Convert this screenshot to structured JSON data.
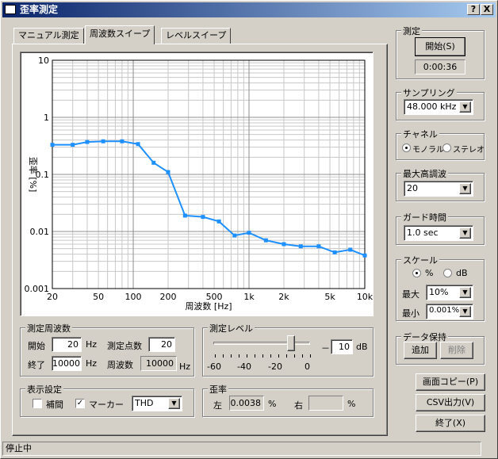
{
  "window": {
    "title": "歪率測定",
    "help_btn": "?",
    "close_btn": "X"
  },
  "tabs": [
    {
      "label": "マニュアル測定",
      "active": false
    },
    {
      "label": "周波数スイープ",
      "active": true
    },
    {
      "label": "レベルスイープ",
      "active": false
    }
  ],
  "chart_data": {
    "type": "line",
    "xscale": "log",
    "yscale": "log",
    "xlim": [
      20,
      10000
    ],
    "ylim": [
      0.001,
      10
    ],
    "xlabel": "周波数 [Hz]",
    "ylabel": "歪率 [%]",
    "x_ticks": [
      "20",
      "50",
      "100",
      "200",
      "500",
      "1k",
      "2k",
      "5k",
      "10k"
    ],
    "x_tick_values": [
      20,
      50,
      100,
      200,
      500,
      1000,
      2000,
      5000,
      10000
    ],
    "y_ticks": [
      "10",
      "1",
      "0.1",
      "0.01",
      "0.001"
    ],
    "y_tick_values": [
      10,
      1,
      0.1,
      0.01,
      0.001
    ],
    "series": [
      {
        "color": "#1e90ff",
        "x": [
          20,
          30,
          40,
          55,
          80,
          110,
          150,
          200,
          280,
          400,
          550,
          750,
          1000,
          1400,
          2000,
          2800,
          4000,
          5500,
          7500,
          10000
        ],
        "y": [
          0.33,
          0.33,
          0.37,
          0.38,
          0.38,
          0.34,
          0.16,
          0.11,
          0.019,
          0.018,
          0.015,
          0.0085,
          0.0095,
          0.007,
          0.006,
          0.0055,
          0.0055,
          0.0043,
          0.0048,
          0.0038
        ]
      }
    ]
  },
  "sweep": {
    "group_label": "測定周波数",
    "start_label": "開始",
    "start_value": "20",
    "start_unit": "Hz",
    "end_label": "終了",
    "end_value": "10000",
    "end_unit": "Hz",
    "points_label": "測定点数",
    "points_value": "20",
    "freq_label": "周波数",
    "freq_value": "10000",
    "freq_unit": "Hz"
  },
  "level": {
    "group_label": "測定レベル",
    "value": "10",
    "unit": "dB",
    "minus": "－",
    "slider_ticks": [
      "-60",
      "-40",
      "-20",
      "0"
    ],
    "slider_fraction": 0.83
  },
  "display": {
    "group_label": "表示設定",
    "interp_label": "補間",
    "interp_checked": false,
    "marker_label": "マーカー",
    "marker_checked": true,
    "mode_value": "THD"
  },
  "distortion": {
    "group_label": "歪率",
    "left_label": "左",
    "left_value": "0.0038",
    "left_unit": "%",
    "right_label": "右",
    "right_value": "",
    "right_unit": "%"
  },
  "measure": {
    "group_label": "測定",
    "start_btn": "開始(S)",
    "elapsed": "0:00:36"
  },
  "sampling": {
    "group_label": "サンプリング",
    "value": "48.000 kHz"
  },
  "channel": {
    "group_label": "チャネル",
    "mono": "モノラル",
    "stereo": "ステレオ",
    "selected": "mono"
  },
  "harmonic": {
    "group_label": "最大高調波",
    "value": "20"
  },
  "guard": {
    "group_label": "ガード時間",
    "value": "1.0 sec"
  },
  "scale": {
    "group_label": "スケール",
    "pct": "%",
    "db": "dB",
    "selected": "pct",
    "max_label": "最大",
    "max_value": "10%",
    "min_label": "最小",
    "min_value": "0.001%"
  },
  "data_hold": {
    "group_label": "データ保持",
    "add_btn": "追加",
    "del_btn": "削除"
  },
  "actions": {
    "copy_btn": "画面コピー(P)",
    "csv_btn": "CSV出力(V)",
    "exit_btn": "終了(X)"
  },
  "status": {
    "text": "停止中"
  }
}
